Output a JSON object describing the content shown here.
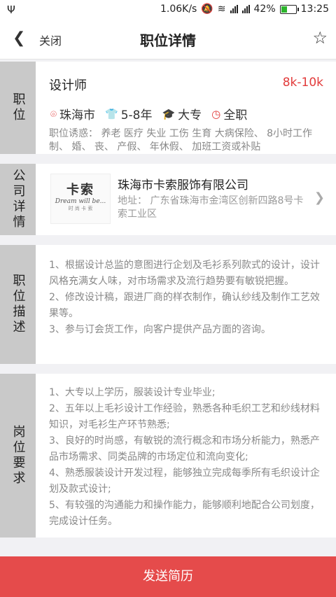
{
  "status_bar": {
    "net_speed": "1.06K/s",
    "battery": "42%",
    "battery_level": 0.42,
    "time": "13:25"
  },
  "header": {
    "back_icon": "chevron-left-icon",
    "close_label": "关闭",
    "title": "职位详情",
    "star_icon": "star-outline-icon"
  },
  "position": {
    "side_label": "职位",
    "title": "设计师",
    "salary": "8k-10k",
    "location": "珠海市",
    "experience": "5-8年",
    "education": "大专",
    "job_type": "全职",
    "benefits": "职位诱惑：  养老  医疗  失业  工伤  生育  大病保险、 8小时工作制、 婚、 丧、 产假、 年休假、 加班工资或补贴"
  },
  "company": {
    "side_label": "公司详情",
    "logo_cn": "卡索",
    "logo_en": "Dream will be...",
    "logo_small": "时 尚 卡 索",
    "name": "珠海市卡索服饰有限公司",
    "address": "地址：  广东省珠海市金湾区创新四路8号卡索工业区"
  },
  "description": {
    "side_label": "职位描述",
    "lines": [
      "1、根据设计总监的意图进行企划及毛衫系列款式的设计，设计风格充满女人味，对市场需求及流行趋势要有敏锐把握。",
      "2、修改设计稿，跟进厂商的样衣制作，确认纱线及制作工艺效果等。",
      "3、参与订会货工作，向客户提供产品方面的咨询。"
    ]
  },
  "requirements": {
    "side_label": "岗位要求",
    "lines": [
      "1、大专以上学历，服装设计专业毕业;",
      "2、五年以上毛衫设计工作经验，熟悉各种毛织工艺和纱线材料知识，对毛衫生产环节熟悉;",
      "3、良好的时尚感，有敏锐的流行概念和市场分析能力，熟悉产品市场需求、同类品牌的市场定位和流向变化;",
      "4、熟悉服装设计开发过程，能够独立完成每季所有毛织设计企划及款式设计;",
      "5、有较强的沟通能力和操作能力，能够顺利地配合公司划度，完成设计任务。"
    ]
  },
  "footer": {
    "send_label": "发送简历",
    "accent_color": "#e54b4b"
  }
}
